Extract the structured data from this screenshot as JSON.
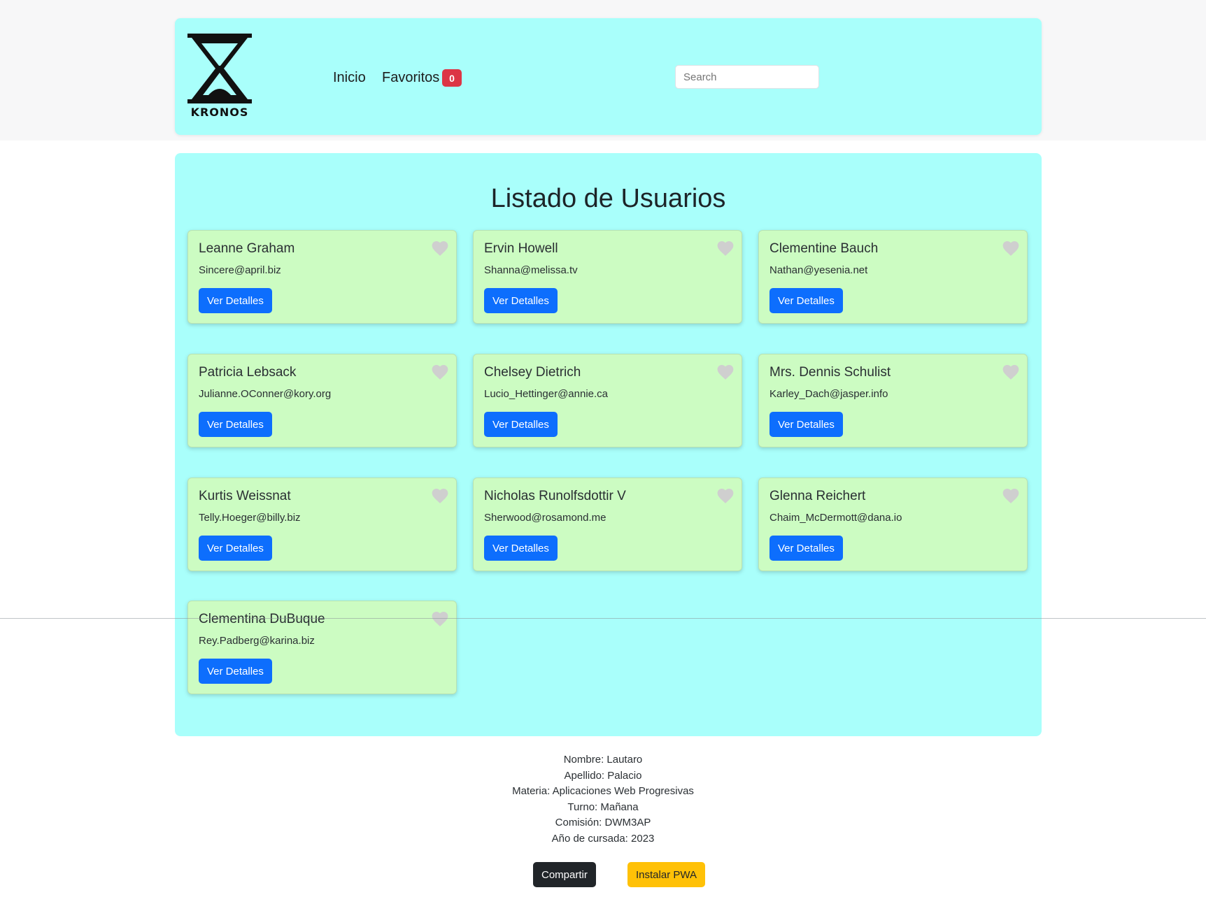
{
  "navbar": {
    "logo_text": "KRONOS",
    "links": [
      "Inicio",
      "Favoritos"
    ],
    "favorites_count": "0",
    "search_placeholder": "Search"
  },
  "main": {
    "title": "Listado de Usuarios",
    "button_label": "Ver Detalles",
    "users": [
      {
        "name": "Leanne Graham",
        "email": "Sincere@april.biz"
      },
      {
        "name": "Ervin Howell",
        "email": "Shanna@melissa.tv"
      },
      {
        "name": "Clementine Bauch",
        "email": "Nathan@yesenia.net"
      },
      {
        "name": "Patricia Lebsack",
        "email": "Julianne.OConner@kory.org"
      },
      {
        "name": "Chelsey Dietrich",
        "email": "Lucio_Hettinger@annie.ca"
      },
      {
        "name": "Mrs. Dennis Schulist",
        "email": "Karley_Dach@jasper.info"
      },
      {
        "name": "Kurtis Weissnat",
        "email": "Telly.Hoeger@billy.biz"
      },
      {
        "name": "Nicholas Runolfsdottir V",
        "email": "Sherwood@rosamond.me"
      },
      {
        "name": "Glenna Reichert",
        "email": "Chaim_McDermott@dana.io"
      },
      {
        "name": "Clementina DuBuque",
        "email": "Rey.Padberg@karina.biz"
      }
    ]
  },
  "footer": {
    "lines": [
      "Nombre: Lautaro",
      "Apellido: Palacio",
      "Materia: Aplicaciones Web Progresivas",
      "Turno: Mañana",
      "Comisión: DWM3AP",
      "Año de cursada: 2023"
    ],
    "share_label": "Compartir",
    "install_label": "Instalar PWA"
  },
  "colors": {
    "panel": "#a9fffb",
    "card": "#ccfcc2",
    "primary_button": "#0d6efd",
    "badge": "#dc3545",
    "install_button": "#ffc107",
    "share_button": "#212529",
    "heart_inactive": "#cfcfcf"
  },
  "icons": {
    "favorite": "heart-icon",
    "logo": "hourglass-logo-icon"
  }
}
